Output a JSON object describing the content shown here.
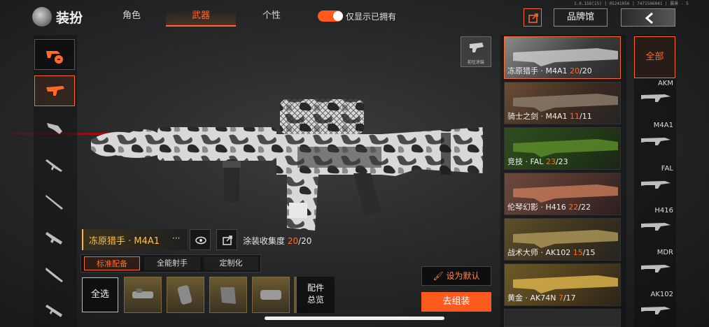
{
  "header": {
    "title": "装扮",
    "tabs": [
      {
        "label": "角色"
      },
      {
        "label": "武器",
        "active": true
      },
      {
        "label": "个性"
      }
    ],
    "toggle_label": "仅显示已拥有",
    "toggle_on": true,
    "version": "1.0.158(15) | 05241056 | 7471506041 | 晨景 - 5",
    "share_icon": "share-icon",
    "brand_label": "品牌馆",
    "back_icon": "back-chevron-icon"
  },
  "left_nav": [
    "lock-tag-icon",
    "assault-rifle-icon",
    "smg-icon",
    "dmr-icon",
    "sniper-icon",
    "shotgun-icon",
    "rifle-icon",
    "lmg-icon"
  ],
  "preview": {
    "label": "前往涂装",
    "icon": "spray-gun-icon"
  },
  "weapon": {
    "name": "冻原猎手 · M4A1",
    "more": "···",
    "collection_label": "涂装收集度",
    "collection_current": "20",
    "collection_total": "/20"
  },
  "subtabs": [
    "标准配备",
    "全能射手",
    "定制化"
  ],
  "attachments": {
    "select_all": "全选",
    "items": [
      "scope-attachment",
      "grip-attachment",
      "stock-attachment",
      "muzzle-attachment"
    ],
    "overview_line1": "配件",
    "overview_line2": "总览"
  },
  "actions": {
    "set_default": "设为默认",
    "go_assemble": "去组装"
  },
  "skins": [
    {
      "name": "冻原猎手 · M4A1 ",
      "current": "20",
      "total": "/20"
    },
    {
      "name": "骑士之剑 · M4A1 ",
      "current": "11",
      "total": "/11"
    },
    {
      "name": "竞技 · FAL ",
      "current": "23",
      "total": "/23"
    },
    {
      "name": "伦琴幻影 · H416 ",
      "current": "22",
      "total": "/22"
    },
    {
      "name": "战术大师 · AK102 ",
      "current": "15",
      "total": "/15"
    },
    {
      "name": "黄金 · AK74N ",
      "current": "7",
      "total": "/17"
    }
  ],
  "categories": {
    "all": "全部",
    "items": [
      "AKM",
      "M4A1",
      "FAL",
      "H416",
      "MDR",
      "AK102"
    ]
  },
  "colors": {
    "accent": "#ff6a2a",
    "gold": "#ffc23a",
    "background": "#141516"
  }
}
